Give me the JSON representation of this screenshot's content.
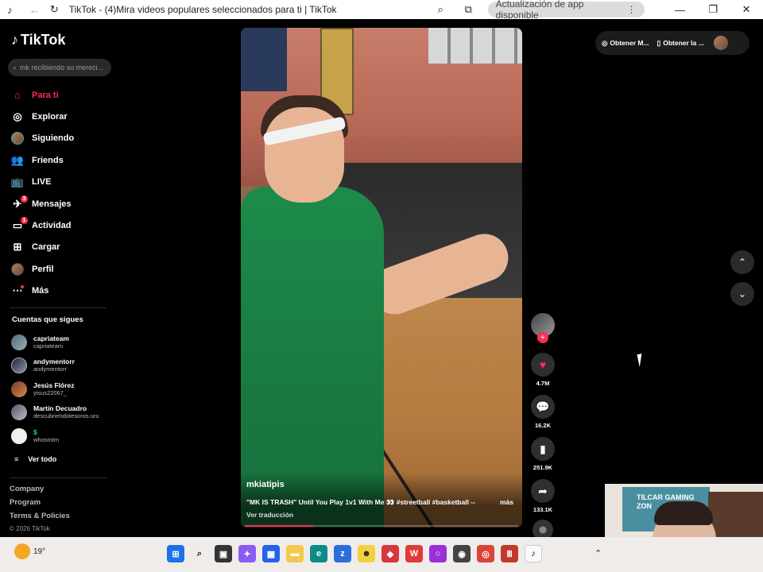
{
  "browser": {
    "title": "TikTok - (4)Mira videos populares seleccionados para ti | TikTok",
    "update_pill": "Actualización de app disponible"
  },
  "sidebar": {
    "logo": "TikTok",
    "search_placeholder": "mk recibiendo su mereci...",
    "nav": [
      {
        "label": "Para ti",
        "icon": "home-icon",
        "active": true
      },
      {
        "label": "Explorar",
        "icon": "compass-icon"
      },
      {
        "label": "Siguiendo",
        "icon": "following-avatar-icon"
      },
      {
        "label": "Friends",
        "icon": "friends-icon"
      },
      {
        "label": "LIVE",
        "icon": "live-tv-icon"
      },
      {
        "label": "Mensajes",
        "icon": "messages-icon",
        "badge": "3"
      },
      {
        "label": "Actividad",
        "icon": "activity-icon",
        "badge": "1"
      },
      {
        "label": "Cargar",
        "icon": "upload-icon"
      },
      {
        "label": "Perfil",
        "icon": "profile-avatar-icon"
      },
      {
        "label": "Más",
        "icon": "more-dots-icon"
      }
    ],
    "following_title": "Cuentas que sigues",
    "following": [
      {
        "name": "capriateam",
        "handle": "capriateam"
      },
      {
        "name": "andymentorr",
        "handle": "andymentorr"
      },
      {
        "name": "Jesús Flórez",
        "handle": "yisus22067_"
      },
      {
        "name": "Martín Decuadro",
        "handle": "descubriendotesoros.uru"
      },
      {
        "name": "$",
        "handle": "whosmtm"
      }
    ],
    "see_all": "Ver todo",
    "footer": [
      "Company",
      "Program",
      "Terms & Policies"
    ],
    "copyright": "© 2026 TikTok"
  },
  "video": {
    "author": "mkiatipis",
    "description": "\"MK IS TRASH\" Until You Play 1v1 With Me 👀 #streetball #basketball --",
    "more": "más",
    "translate": "Ver traducción",
    "progress": 0.25
  },
  "actions": {
    "likes": "4.7M",
    "comments": "16.2K",
    "saves": "251.9K",
    "shares": "133.1K"
  },
  "top_right": {
    "item1": "Obtener M...",
    "item2": "Obtener la ..."
  },
  "webcam": {
    "sign": "TILCAR GAMING ZON"
  },
  "taskbar": {
    "weather": "19°"
  },
  "colors": {
    "accent": "#fe2c55",
    "background": "#000000"
  }
}
